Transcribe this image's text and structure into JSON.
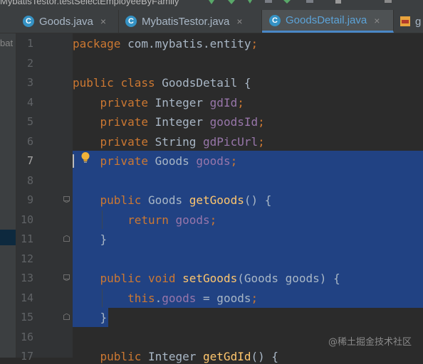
{
  "toolbar": {
    "run_config": "MybatisTestor.testSelectEmployeeByFamily"
  },
  "tabs": [
    {
      "label": "Goods.java",
      "icon": "class-icon"
    },
    {
      "label": "MybatisTestor.java",
      "icon": "class-icon"
    },
    {
      "label": "GoodsDetail.java",
      "icon": "class-icon",
      "active": true
    },
    {
      "label": "g",
      "icon": "xml-icon"
    }
  ],
  "project_panel": {
    "visible_fragment": "bat"
  },
  "editor": {
    "current_line": 7,
    "lines": [
      {
        "n": "1",
        "code": "package com.mybatis.entity;"
      },
      {
        "n": "2",
        "code": ""
      },
      {
        "n": "3",
        "code": "public class GoodsDetail {"
      },
      {
        "n": "4",
        "code": "    private Integer gdId;"
      },
      {
        "n": "5",
        "code": "    private Integer goodsId;"
      },
      {
        "n": "6",
        "code": "    private String gdPicUrl;"
      },
      {
        "n": "7",
        "code": "    private Goods goods;"
      },
      {
        "n": "8",
        "code": ""
      },
      {
        "n": "9",
        "code": "    public Goods getGoods() {"
      },
      {
        "n": "10",
        "code": "        return goods;"
      },
      {
        "n": "11",
        "code": "    }"
      },
      {
        "n": "12",
        "code": ""
      },
      {
        "n": "13",
        "code": "    public void setGoods(Goods goods) {"
      },
      {
        "n": "14",
        "code": "        this.goods = goods;"
      },
      {
        "n": "15",
        "code": "    }"
      },
      {
        "n": "16",
        "code": ""
      },
      {
        "n": "17",
        "code": "    public Integer getGdId() {"
      }
    ]
  },
  "watermark": "@稀土掘金技术社区",
  "colors": {
    "background": "#2b2b2b",
    "gutter": "#313335",
    "selection": "#214283",
    "keyword": "#cc7832",
    "field": "#9876aa",
    "method": "#ffc66d",
    "text": "#a9b7c6",
    "active_tab_text": "#5ca3d8"
  }
}
